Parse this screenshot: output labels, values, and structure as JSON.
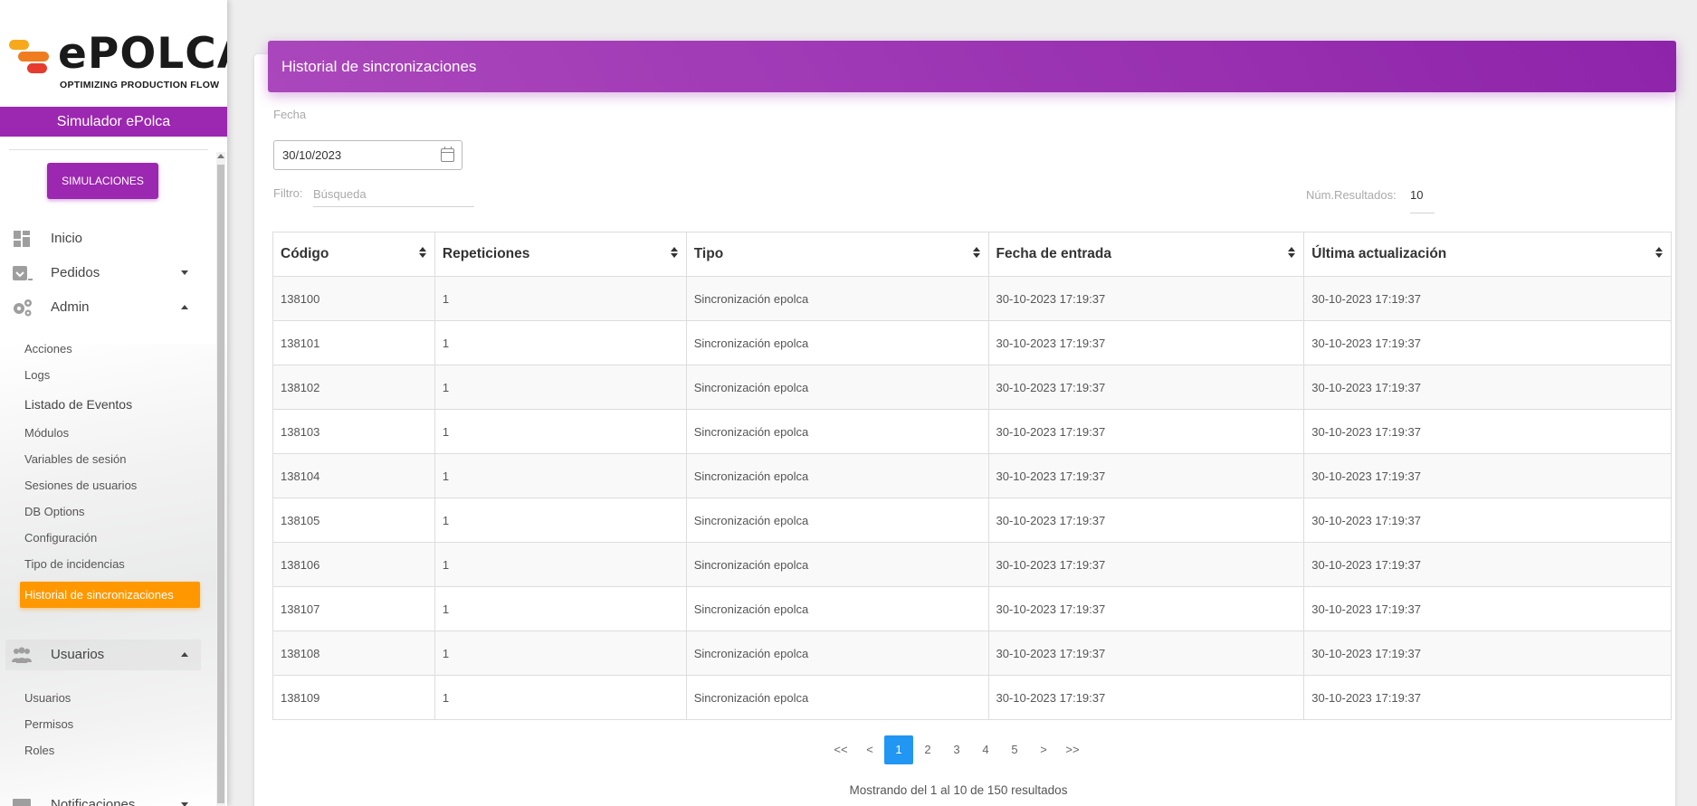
{
  "brand": {
    "name": "ePOLCA",
    "tagline": "OPTIMIZING PRODUCTION FLOW",
    "app_title": "Simulador ePolca"
  },
  "sidebar": {
    "simulations_button": "SIMULACIONES",
    "nav": [
      {
        "label": "Inicio",
        "icon": "dashboard-icon"
      },
      {
        "label": "Pedidos",
        "icon": "inbox-icon",
        "expanded": false
      },
      {
        "label": "Admin",
        "icon": "gears-icon",
        "expanded": true
      }
    ],
    "admin_items": [
      "Acciones",
      "Logs",
      "Listado de Eventos",
      "Módulos",
      "Variables de sesión",
      "Sesiones de usuarios",
      "DB Options",
      "Configuración",
      "Tipo de incidencias",
      "Historial de sincronizaciones"
    ],
    "usuarios": {
      "label": "Usuarios",
      "icon": "users-icon",
      "expanded": true
    },
    "usuarios_items": [
      "Usuarios",
      "Permisos",
      "Roles"
    ],
    "notificaciones": {
      "label": "Notificaciones",
      "icon": "envelope-icon"
    },
    "active_item": "Historial de sincronizaciones",
    "colors": {
      "primary": "#9c27b0",
      "active": "#ff9800"
    }
  },
  "main": {
    "title": "Historial de sincronizaciones",
    "date_label": "Fecha",
    "date_value": "30/10/2023",
    "filter_label": "Filtro:",
    "filter_placeholder": "Búsqueda",
    "results_label": "Núm.Resultados:",
    "results_value": "10",
    "table": {
      "columns": [
        "Código",
        "Repeticiones",
        "Tipo",
        "Fecha de entrada",
        "Última actualización"
      ],
      "rows": [
        [
          "138100",
          "1",
          "Sincronización epolca",
          "30-10-2023 17:19:37",
          "30-10-2023 17:19:37"
        ],
        [
          "138101",
          "1",
          "Sincronización epolca",
          "30-10-2023 17:19:37",
          "30-10-2023 17:19:37"
        ],
        [
          "138102",
          "1",
          "Sincronización epolca",
          "30-10-2023 17:19:37",
          "30-10-2023 17:19:37"
        ],
        [
          "138103",
          "1",
          "Sincronización epolca",
          "30-10-2023 17:19:37",
          "30-10-2023 17:19:37"
        ],
        [
          "138104",
          "1",
          "Sincronización epolca",
          "30-10-2023 17:19:37",
          "30-10-2023 17:19:37"
        ],
        [
          "138105",
          "1",
          "Sincronización epolca",
          "30-10-2023 17:19:37",
          "30-10-2023 17:19:37"
        ],
        [
          "138106",
          "1",
          "Sincronización epolca",
          "30-10-2023 17:19:37",
          "30-10-2023 17:19:37"
        ],
        [
          "138107",
          "1",
          "Sincronización epolca",
          "30-10-2023 17:19:37",
          "30-10-2023 17:19:37"
        ],
        [
          "138108",
          "1",
          "Sincronización epolca",
          "30-10-2023 17:19:37",
          "30-10-2023 17:19:37"
        ],
        [
          "138109",
          "1",
          "Sincronización epolca",
          "30-10-2023 17:19:37",
          "30-10-2023 17:19:37"
        ]
      ]
    },
    "pagination": {
      "first": "<<",
      "prev": "<",
      "pages": [
        "1",
        "2",
        "3",
        "4",
        "5"
      ],
      "current": "1",
      "next": ">",
      "last": ">>"
    },
    "footer": "Mostrando del 1 al 10 de 150 resultados"
  }
}
